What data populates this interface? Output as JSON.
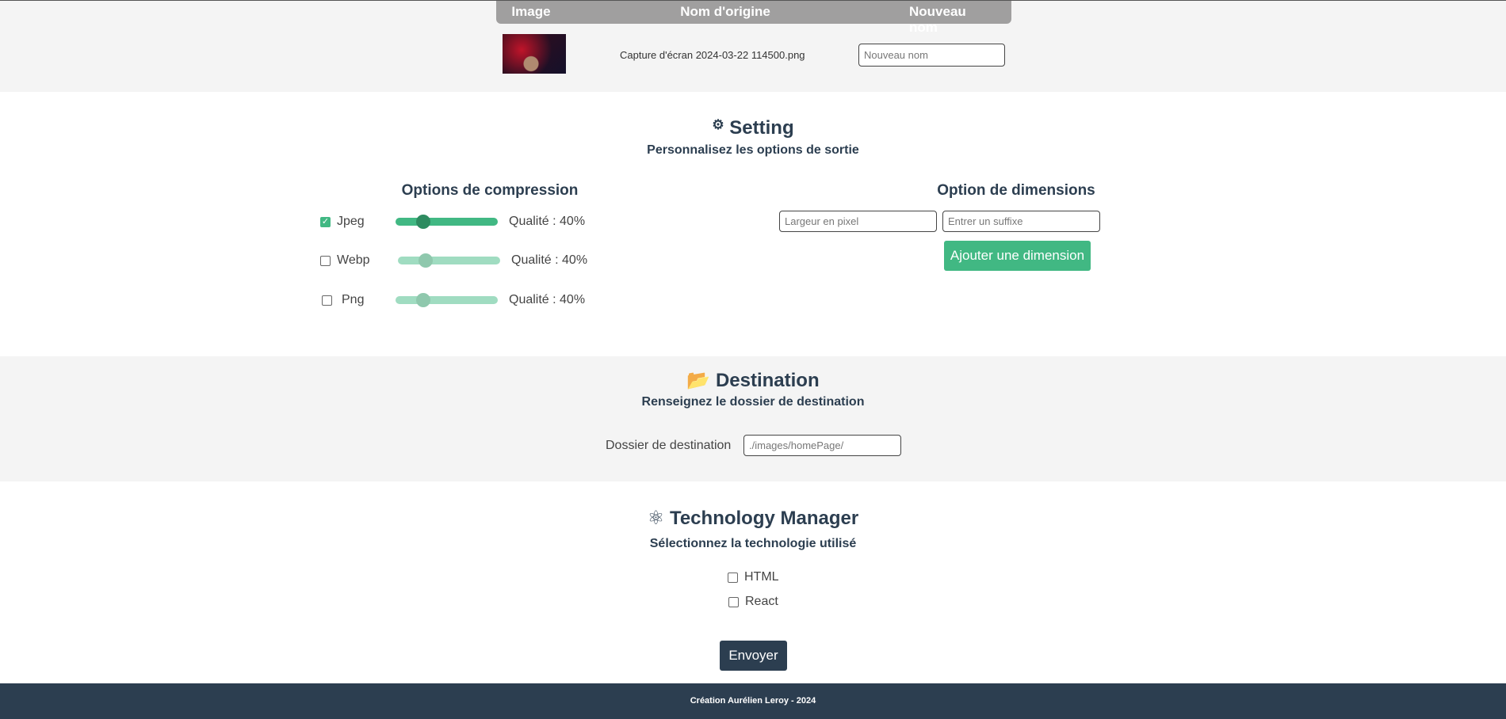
{
  "table": {
    "headers": [
      "Image",
      "Nom d'origine",
      "Nouveau nom"
    ],
    "rows": [
      {
        "original_name": "Capture d'écran 2024-03-22 114500.png",
        "new_name_value": "",
        "new_name_placeholder": "Nouveau nom"
      }
    ]
  },
  "setting": {
    "title": "Setting",
    "subtitle": "Personnalisez les options de sortie",
    "compression": {
      "title": "Options de compression",
      "items": [
        {
          "label": "Jpeg",
          "checked": true,
          "quality": 40,
          "quality_text": "Qualité : 40%"
        },
        {
          "label": "Webp",
          "checked": false,
          "quality": 40,
          "quality_text": "Qualité : 40%"
        },
        {
          "label": "Png",
          "checked": false,
          "quality": 40,
          "quality_text": "Qualité : 40%"
        }
      ]
    },
    "dimensions": {
      "title": "Option de dimensions",
      "width_placeholder": "Largeur en pixel",
      "suffix_placeholder": "Entrer un suffixe",
      "add_label": "Ajouter une dimension"
    }
  },
  "destination": {
    "title": "Destination",
    "subtitle": "Renseignez le dossier de destination",
    "label": "Dossier de destination",
    "placeholder": "./images/homePage/"
  },
  "technology": {
    "title": "Technology Manager",
    "subtitle": "Sélectionnez la technologie utilisé",
    "options": [
      {
        "label": "HTML",
        "checked": false
      },
      {
        "label": "React",
        "checked": false
      }
    ]
  },
  "submit_label": "Envoyer",
  "footer": {
    "text": "Création Aurélien Leroy - 2024"
  },
  "colors": {
    "accent": "#41b883",
    "accent_light": "#a0dcc1",
    "dark": "#2c3e50",
    "header_gray": "#a09f9f",
    "band": "#f4f4f4"
  }
}
